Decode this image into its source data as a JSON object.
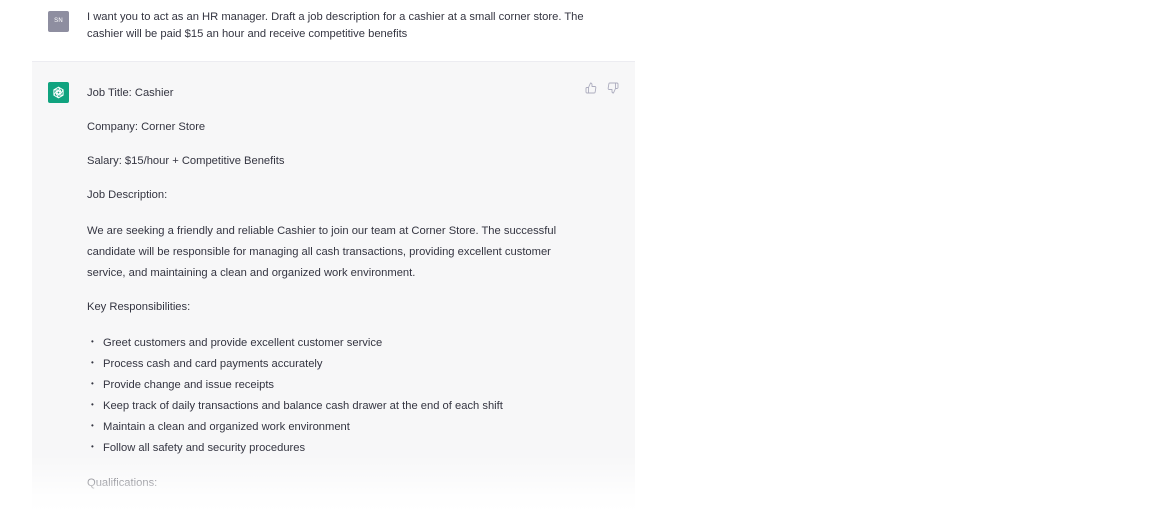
{
  "user_message": {
    "avatar_initials": "SN",
    "text": "I want you to act as an HR manager. Draft a job description for a cashier at a small corner store. The cashier will be paid $15 an hour and receive competitive benefits"
  },
  "assistant_message": {
    "avatar_icon": "openai-logo-icon",
    "feedback_icons": [
      "thumbs-up-icon",
      "thumbs-down-icon"
    ],
    "job_title": "Job Title: Cashier",
    "company": "Company: Corner Store",
    "salary": "Salary: $15/hour + Competitive Benefits",
    "description_heading": "Job Description:",
    "description": "We are seeking a friendly and reliable Cashier to join our team at Corner Store. The successful candidate will be responsible for managing all cash transactions, providing excellent customer service, and maintaining a clean and organized work environment.",
    "responsibilities_heading": "Key Responsibilities:",
    "responsibilities": [
      "Greet customers and provide excellent customer service",
      "Process cash and card payments accurately",
      "Provide change and issue receipts",
      "Keep track of daily transactions and balance cash drawer at the end of each shift",
      "Maintain a clean and organized work environment",
      "Follow all safety and security procedures"
    ],
    "qualifications_heading": "Qualifications:"
  },
  "colors": {
    "user_avatar": "#8e8ea0",
    "bot_avatar": "#10a37f",
    "assistant_bg": "#f7f7f8",
    "text": "#343541"
  }
}
